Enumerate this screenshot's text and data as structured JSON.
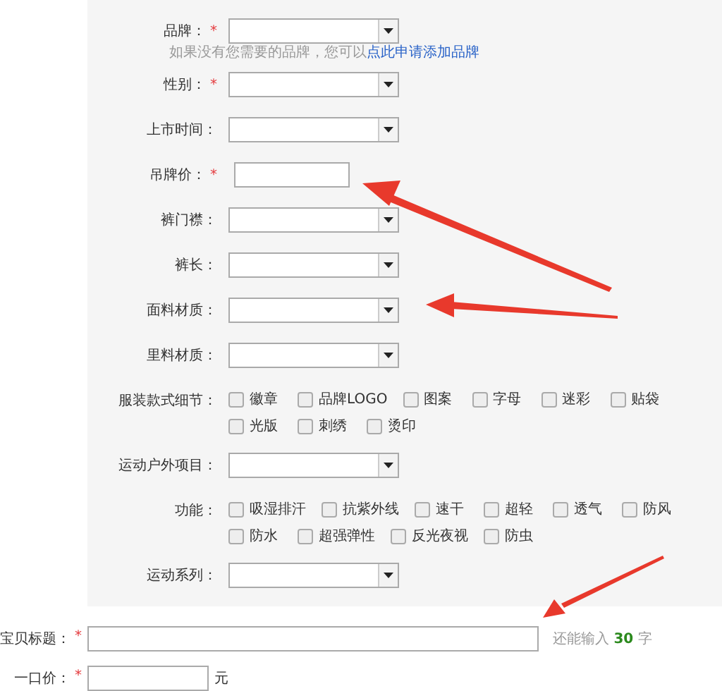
{
  "attributes": [
    {
      "kind": "select",
      "label": "品牌：",
      "required_mark": "*"
    },
    {
      "kind": "hint",
      "text": "如果没有您需要的品牌，您可以",
      "link": "点此申请添加品牌"
    },
    {
      "kind": "select",
      "label": "性别：",
      "required_mark": "*"
    },
    {
      "kind": "select",
      "label": "上市时间："
    },
    {
      "kind": "text",
      "label": "吊牌价：",
      "required_mark": "*"
    },
    {
      "kind": "select",
      "label": "裤门襟："
    },
    {
      "kind": "select",
      "label": "裤长："
    },
    {
      "kind": "select",
      "label": "面料材质："
    },
    {
      "kind": "select",
      "label": "里料材质："
    },
    {
      "kind": "checkboxes",
      "label": "服装款式细节：",
      "options": [
        {
          "label": "徽章",
          "checked": false
        },
        {
          "label": "品牌LOGO",
          "checked": false
        },
        {
          "label": "图案",
          "checked": false
        },
        {
          "label": "字母",
          "checked": false
        },
        {
          "label": "迷彩",
          "checked": false
        },
        {
          "label": "贴袋",
          "checked": false
        },
        {
          "label": "光版",
          "checked": false
        },
        {
          "label": "刺绣",
          "checked": false
        },
        {
          "label": "烫印",
          "checked": false
        }
      ]
    },
    {
      "kind": "select",
      "label": "运动户外项目："
    },
    {
      "kind": "checkboxes",
      "label": "功能：",
      "options": [
        {
          "label": "吸湿排汗",
          "checked": false
        },
        {
          "label": "抗紫外线",
          "checked": false
        },
        {
          "label": "速干",
          "checked": false
        },
        {
          "label": "超轻",
          "checked": false
        },
        {
          "label": "透气",
          "checked": false
        },
        {
          "label": "防风",
          "checked": false
        },
        {
          "label": "防水",
          "checked": false
        },
        {
          "label": "超强弹性",
          "checked": false
        },
        {
          "label": "反光夜视",
          "checked": false
        },
        {
          "label": "防虫",
          "checked": false
        }
      ]
    },
    {
      "kind": "select",
      "label": "运动系列："
    }
  ],
  "title_field": {
    "label": "宝贝标题：",
    "required_mark": "*",
    "counter": "还能输入 **30** 字"
  },
  "price_field": {
    "label": "一口价：",
    "required_mark": "*",
    "unit": "元"
  }
}
